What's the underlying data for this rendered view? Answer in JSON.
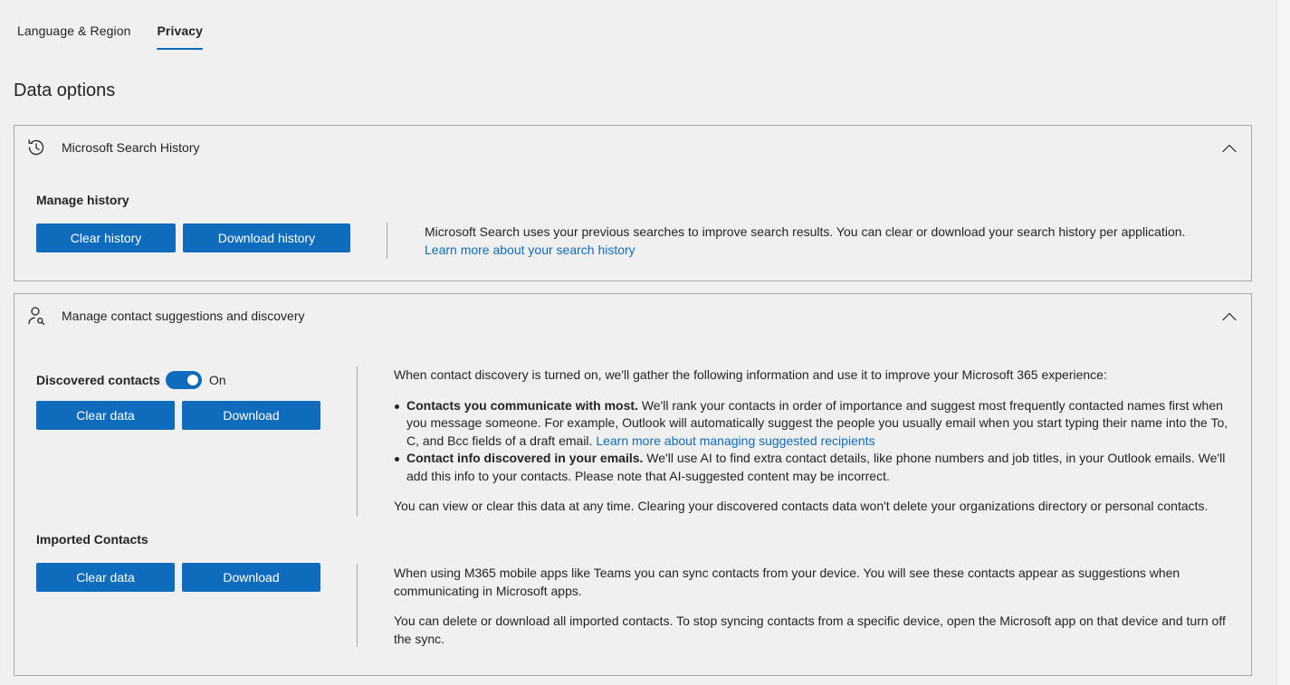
{
  "tabs": [
    {
      "label": "Language & Region",
      "active": false
    },
    {
      "label": "Privacy",
      "active": true
    }
  ],
  "page_title": "Data options",
  "search_history": {
    "title": "Microsoft Search History",
    "icon": "history-icon",
    "sub_label": "Manage history",
    "clear_button": "Clear history",
    "download_button": "Download history",
    "description": "Microsoft Search uses your previous searches to improve search results. You can clear or download your search history per application.",
    "link_text": "Learn more about your search history"
  },
  "contacts": {
    "title": "Manage contact suggestions and discovery",
    "icon": "person-search-icon",
    "discovered": {
      "label": "Discovered contacts",
      "toggle_on": true,
      "toggle_state": "On",
      "clear_button": "Clear data",
      "download_button": "Download",
      "intro": "When contact discovery is turned on, we'll gather the following information and use it to improve your Microsoft 365 experience:",
      "bullet1_title": "Contacts you communicate with most.",
      "bullet1_text": " We'll rank your contacts in order of importance and suggest most frequently contacted names first when you message someone. For example, Outlook will automatically suggest the people you usually email when you start typing their name into the To, C, and Bcc fields of a draft email. ",
      "bullet1_link": "Learn more about managing suggested recipients",
      "bullet2_title": "Contact info discovered in your emails.",
      "bullet2_text": " We'll use AI to find extra contact details, like phone numbers and job titles, in your Outlook emails. We'll add this info to your contacts. Please note that AI-suggested content may be incorrect.",
      "footer": "You can view or clear this data at any time. Clearing your discovered contacts data won't delete your organizations directory or personal contacts."
    },
    "imported": {
      "label": "Imported Contacts",
      "clear_button": "Clear data",
      "download_button": "Download",
      "para1": "When using M365 mobile apps like Teams you can sync contacts from your device. You will see these contacts appear as suggestions when communicating in Microsoft apps.",
      "para2": "You can delete or download all imported contacts. To stop syncing contacts from a specific device, open the Microsoft app on that device and turn off the sync."
    }
  },
  "colors": {
    "accent": "#0f6cbd",
    "background": "#f0f0f0",
    "border": "#a8a8a8",
    "text": "#242424"
  }
}
